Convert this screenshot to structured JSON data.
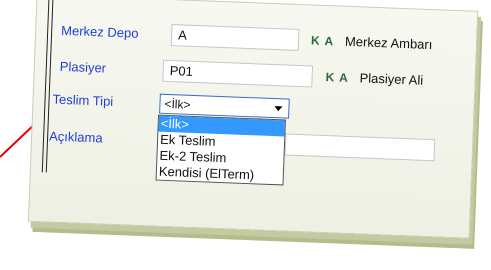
{
  "form": {
    "depot_label": "Merkez Depo",
    "depot_value": "A",
    "depot_ka": "K A",
    "depot_desc": "Merkez Ambarı",
    "salesman_label": "Plasiyer",
    "salesman_value": "P01",
    "salesman_ka": "K A",
    "salesman_desc": "Plasiyer Ali",
    "delivery_label": "Teslim Tipi",
    "delivery_selected": "<İlk>",
    "notes_label": "Açıklama"
  },
  "delivery_options": [
    "<İlk>",
    "Ek Teslim",
    "Ek-2 Teslim",
    "Kendisi (ElTerm)"
  ],
  "colors": {
    "label": "#1f3fd6",
    "highlight": "#3399ff",
    "pointer_arrow": "#e00000"
  }
}
